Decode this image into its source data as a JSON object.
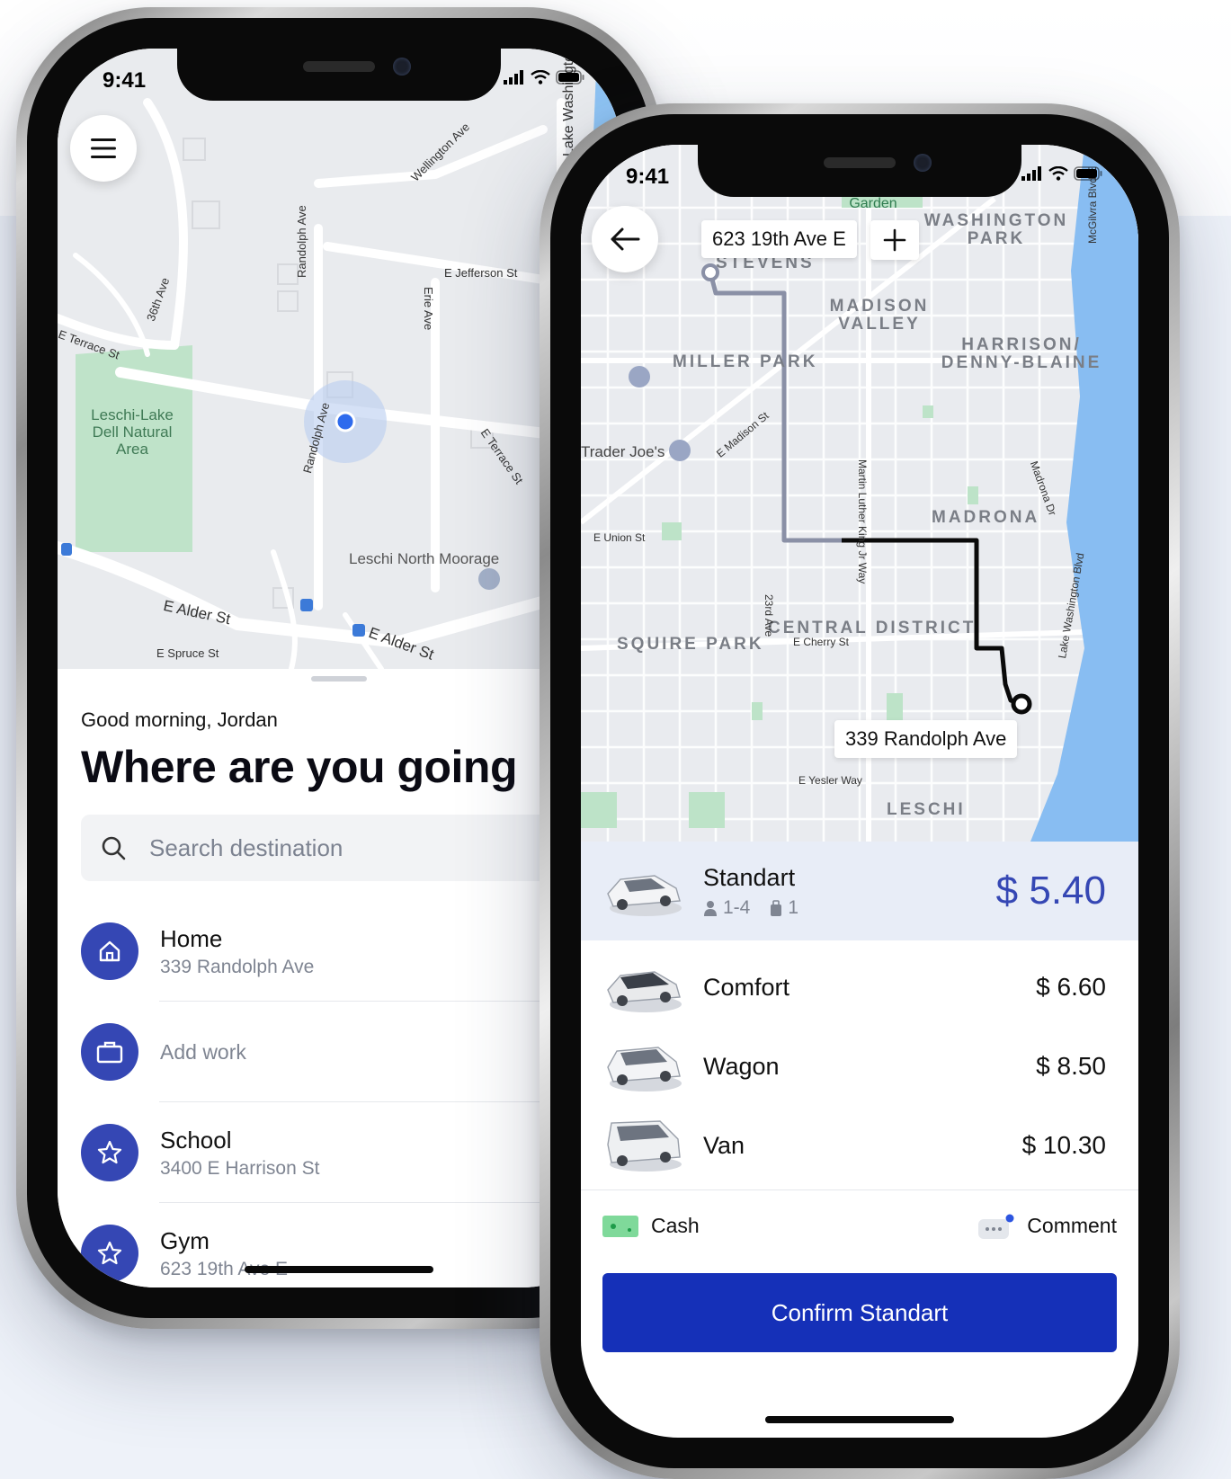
{
  "phone1": {
    "status_time": "9:41",
    "map": {
      "streets": [
        "E Jefferson St",
        "Randolph Ave",
        "Erie Ave",
        "36th Ave",
        "E Terrace St",
        "Wellington Ave",
        "Lake Washington",
        "E Alder St",
        "E Spruce St",
        "Randolph Ave",
        "E Terrace St",
        "E Alder St"
      ],
      "areas": [
        "Leschi-Lake Dell Natural Area"
      ],
      "pois": [
        "Leschi North Moorage"
      ]
    },
    "greeting": "Good morning, Jordan",
    "headline": "Where are you going",
    "search": {
      "placeholder": "Search destination"
    },
    "places": [
      {
        "name": "Home",
        "address": "339 Randolph Ave",
        "icon": "home-icon"
      },
      {
        "name": "Add work",
        "address": "",
        "icon": "briefcase-icon"
      },
      {
        "name": "School",
        "address": "3400 E Harrison St",
        "icon": "star-icon"
      },
      {
        "name": "Gym",
        "address": "623 19th Ave E",
        "icon": "star-icon"
      }
    ]
  },
  "phone2": {
    "status_time": "9:41",
    "map": {
      "origin_label": "623 19th Ave E",
      "destination_label": "339 Randolph Ave",
      "districts": [
        "STEVENS",
        "MADISON VALLEY",
        "WASHINGTON PARK",
        "MILLER PARK",
        "HARRISON/ DENNY-BLAINE",
        "MADRONA",
        "CENTRAL DISTRICT",
        "SQUIRE PARK",
        "LESCHI"
      ],
      "places": [
        "Japanese Garden",
        "Trader Joe's",
        "E Madison St",
        "E Union St",
        "23rd Ave",
        "E Cherry St",
        "E Yesler Way",
        "Martin Luther King Jr Way",
        "Madrona Dr",
        "Lake Washington Blvd",
        "McGilvra Blvd E"
      ]
    },
    "rides": [
      {
        "name": "Standart",
        "price": "$ 5.40",
        "passengers": "1-4",
        "luggage": "1",
        "selected": true
      },
      {
        "name": "Comfort",
        "price": "$ 6.60"
      },
      {
        "name": "Wagon",
        "price": "$ 8.50"
      },
      {
        "name": "Van",
        "price": "$ 10.30"
      }
    ],
    "payment": {
      "method": "Cash",
      "comment": "Comment"
    },
    "confirm_label": "Confirm Standart"
  },
  "colors": {
    "accent": "#3547b4",
    "confirm": "#1530b8",
    "selected_row": "#e8edf7",
    "water": "#88bdf2",
    "park": "#b9e2c5"
  }
}
